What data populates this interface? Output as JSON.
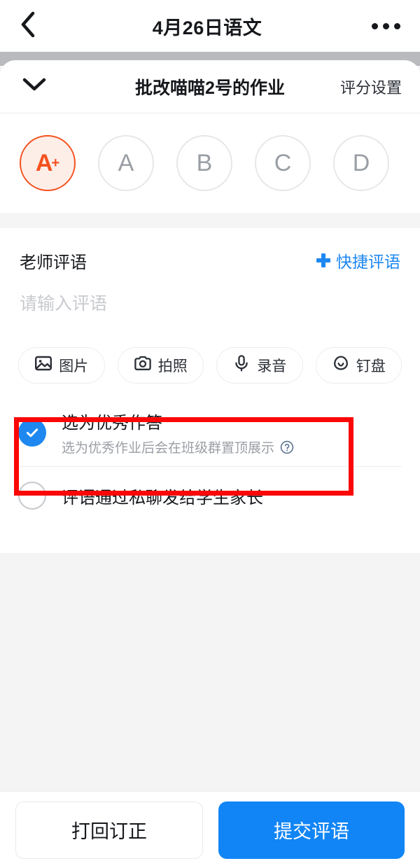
{
  "navbar": {
    "back_icon": "chevron-left-icon",
    "title": "4月26日语文",
    "more_icon": "more-dots-icon"
  },
  "sheet": {
    "collapse_icon": "chevron-down-icon",
    "title": "批改喵喵2号的作业",
    "settings_label": "评分设置"
  },
  "grades": {
    "items": [
      {
        "label": "A",
        "sup": "+",
        "selected": true
      },
      {
        "label": "A",
        "sup": "",
        "selected": false
      },
      {
        "label": "B",
        "sup": "",
        "selected": false
      },
      {
        "label": "C",
        "sup": "",
        "selected": false
      },
      {
        "label": "D",
        "sup": "",
        "selected": false
      }
    ],
    "selected_color": "#f4511e",
    "selected_bg": "#fdeee8",
    "unselected_color": "#9a9ea5"
  },
  "comment": {
    "label": "老师评语",
    "quick_label": "快捷评语",
    "quick_icon": "plus-icon",
    "quick_color": "#1e88f0",
    "placeholder": "请输入评语",
    "value": ""
  },
  "attachments": [
    {
      "label": "图片",
      "icon": "image-icon"
    },
    {
      "label": "拍照",
      "icon": "camera-icon"
    },
    {
      "label": "录音",
      "icon": "microphone-icon"
    },
    {
      "label": "钉盘",
      "icon": "dingdisk-icon"
    }
  ],
  "options": [
    {
      "title": "选为优秀作答",
      "subtitle": "选为优秀作业后会在班级群置顶展示",
      "help_icon": "question-mark-icon",
      "checked": true
    },
    {
      "title": "评语通过私聊发给学生家长",
      "subtitle": "",
      "checked": false
    }
  ],
  "annotation": {
    "color": "#fb0707",
    "target": "选为优秀作答"
  },
  "footer": {
    "secondary_label": "打回订正",
    "primary_label": "提交评语",
    "primary_color": "#1185f5"
  }
}
